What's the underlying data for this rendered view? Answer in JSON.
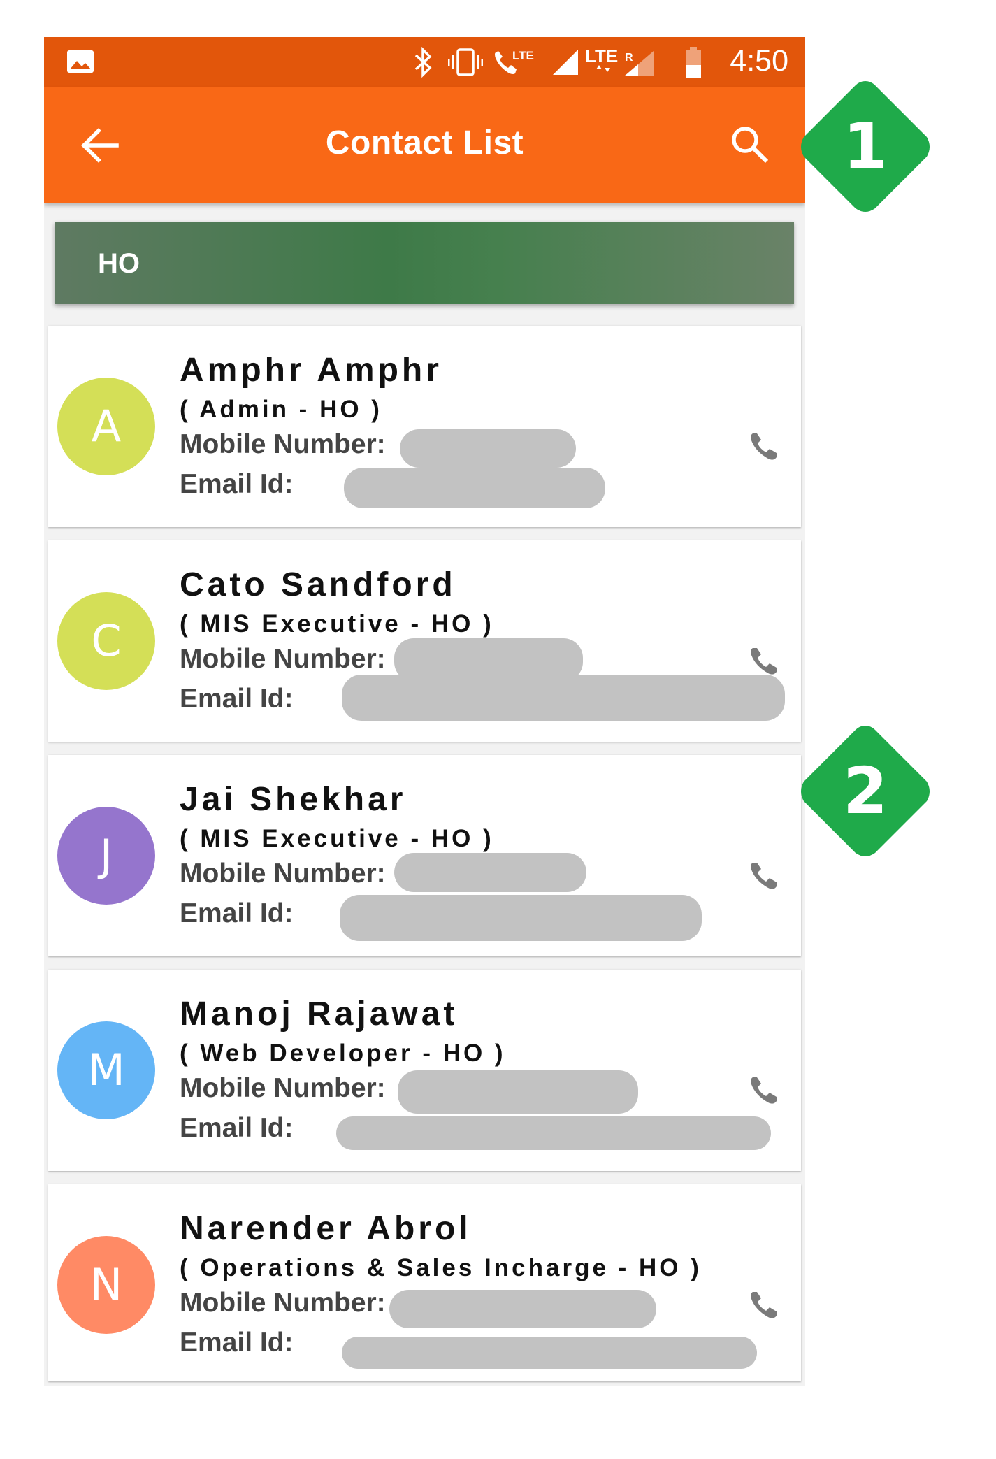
{
  "status_bar": {
    "time": "4:50",
    "icons": [
      "image-icon",
      "bluetooth-icon",
      "vibrate-icon",
      "volte-call-icon",
      "signal-icon",
      "lte-icon",
      "roaming-signal-icon",
      "battery-icon"
    ],
    "lte_label": "LTE",
    "roaming_label": "R"
  },
  "app_bar": {
    "title": "Contact List",
    "back_icon": "arrow-back-icon",
    "search_icon": "search-icon",
    "color": "#f96816"
  },
  "group": {
    "label": "HO"
  },
  "labels": {
    "mobile": "Mobile Number:",
    "email": "Email Id:"
  },
  "contacts": [
    {
      "initial": "A",
      "name": "Amphr Amphr",
      "role": "( Admin - HO )",
      "avatar_color": "#d4df57"
    },
    {
      "initial": "C",
      "name": "Cato Sandford",
      "role": "( MIS Executive - HO )",
      "avatar_color": "#d4df57"
    },
    {
      "initial": "J",
      "name": "Jai Shekhar",
      "role": "( MIS Executive - HO )",
      "avatar_color": "#9575cd"
    },
    {
      "initial": "M",
      "name": "Manoj Rajawat",
      "role": "( Web Developer - HO )",
      "avatar_color": "#64b5f6"
    },
    {
      "initial": "N",
      "name": "Narender Abrol",
      "role": "( Operations & Sales Incharge - HO )",
      "avatar_color": "#ff8a65"
    }
  ],
  "callouts": [
    {
      "number": "1",
      "color": "#1faa4a"
    },
    {
      "number": "2",
      "color": "#1faa4a"
    }
  ]
}
